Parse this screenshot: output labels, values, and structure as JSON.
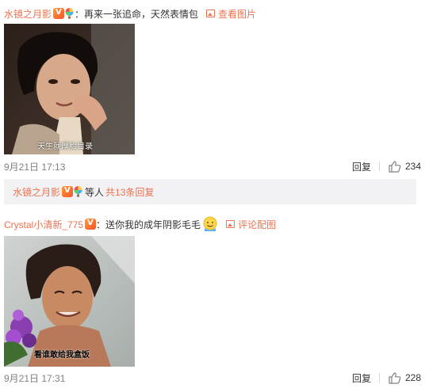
{
  "comments": [
    {
      "user": "水镜之月影",
      "text": "：再来一张追命，天然表情包",
      "view_link": "查看图片",
      "image_caption": "天生就厚脸目录",
      "time": "9月21日 17:13",
      "reply": "回复",
      "likes": "234"
    },
    {
      "user": "Crystal小清新_775",
      "text": "：送你我的成年阴影毛毛",
      "view_link": "评论配图",
      "image_caption": "看谁敢给我盒饭",
      "time": "9月21日 17:31",
      "reply": "回复",
      "likes": "228"
    }
  ],
  "subreplies": {
    "user": "水镜之月影",
    "etc": "等人",
    "total": "共13条回复"
  },
  "colors": {
    "link": "#eb7350",
    "meta": "#808080",
    "subreply_bg": "#f2f2f5"
  }
}
